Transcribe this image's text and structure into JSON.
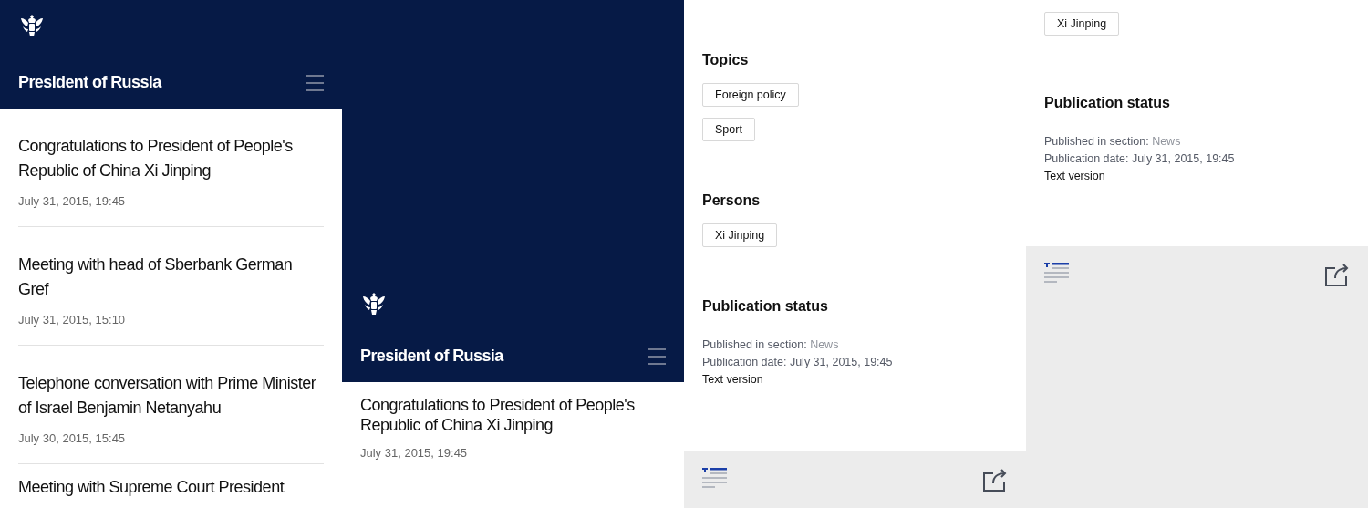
{
  "screens": [
    {
      "kind": "list",
      "header": {
        "title": "President of Russia"
      },
      "news": [
        {
          "title": "Congratulations to President of People's Republic of China Xi Jinping",
          "date": "July 31, 2015, 19:45"
        },
        {
          "title": "Meeting with head of Sberbank German Gref",
          "date": "July 31, 2015, 15:10"
        },
        {
          "title": "Telephone conversation with Prime Minister of Israel Benjamin Netanyahu",
          "date": "July 30, 2015, 15:45"
        },
        {
          "title": "Meeting with Supreme Court President"
        }
      ]
    },
    {
      "kind": "list-pulled",
      "header": {
        "title": "President of Russia"
      },
      "news": [
        {
          "title": "Congratulations to President of People's Republic of China Xi Jinping",
          "date": "July 31, 2015, 19:45"
        }
      ]
    },
    {
      "kind": "details",
      "sections": [
        {
          "kind": "tags",
          "heading": "Topics",
          "tags": [
            "Foreign policy",
            "Sport"
          ]
        },
        {
          "kind": "tags",
          "heading": "Persons",
          "tags": [
            "Xi Jinping"
          ]
        },
        {
          "kind": "status",
          "heading": "Publication status",
          "section_label": "Published in section:",
          "section": "News",
          "date": "Publication date: July 31, 2015, 19:45",
          "link": "Text version"
        }
      ],
      "toolbar": true
    },
    {
      "kind": "details",
      "sections": [
        {
          "kind": "tags",
          "tags": [
            "Xi Jinping"
          ]
        },
        {
          "kind": "status",
          "heading": "Publication status",
          "section_label": "Published in section:",
          "section": "News",
          "date": "Publication date: July 31, 2015, 19:45",
          "link": "Text version"
        }
      ],
      "toolbar": true
    }
  ]
}
